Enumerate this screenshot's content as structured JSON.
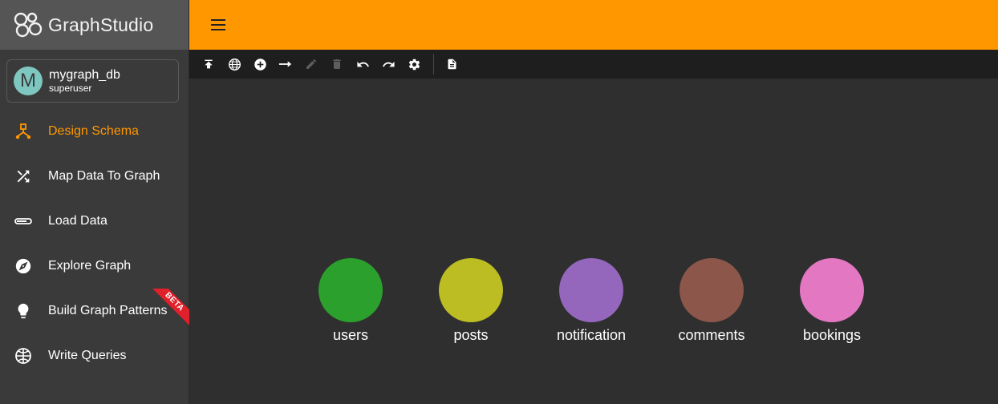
{
  "brand": {
    "name_part1": "Graph",
    "name_part2": "Studio"
  },
  "user": {
    "initial": "M",
    "name": "mygraph_db",
    "role": "superuser"
  },
  "nav": {
    "items": [
      {
        "label": "Design Schema",
        "active": true
      },
      {
        "label": "Map Data To Graph"
      },
      {
        "label": "Load Data"
      },
      {
        "label": "Explore Graph"
      },
      {
        "label": "Build Graph Patterns",
        "badge": "BETA"
      },
      {
        "label": "Write Queries"
      }
    ]
  },
  "colors": {
    "accent": "#ff9800",
    "sidebar": "#3a3a3a",
    "canvas": "#2f2f2f",
    "toolbar": "#1e1e1e"
  },
  "toolbar": {
    "tools": [
      {
        "icon": "publish-icon",
        "disabled": false
      },
      {
        "icon": "globe-icon",
        "disabled": false
      },
      {
        "icon": "add-vertex-icon",
        "disabled": false
      },
      {
        "icon": "add-edge-icon",
        "disabled": false
      },
      {
        "icon": "edit-icon",
        "disabled": true
      },
      {
        "icon": "delete-icon",
        "disabled": true
      },
      {
        "icon": "undo-icon",
        "disabled": false
      },
      {
        "icon": "redo-icon",
        "disabled": false
      },
      {
        "icon": "settings-icon",
        "disabled": false
      },
      {
        "icon": "document-icon",
        "disabled": false
      }
    ]
  },
  "schema": {
    "vertices": [
      {
        "label": "users",
        "color": "#2ca02c"
      },
      {
        "label": "posts",
        "color": "#bcbd22"
      },
      {
        "label": "notification",
        "color": "#9467bd"
      },
      {
        "label": "comments",
        "color": "#8c564b"
      },
      {
        "label": "bookings",
        "color": "#e377c2"
      }
    ]
  }
}
